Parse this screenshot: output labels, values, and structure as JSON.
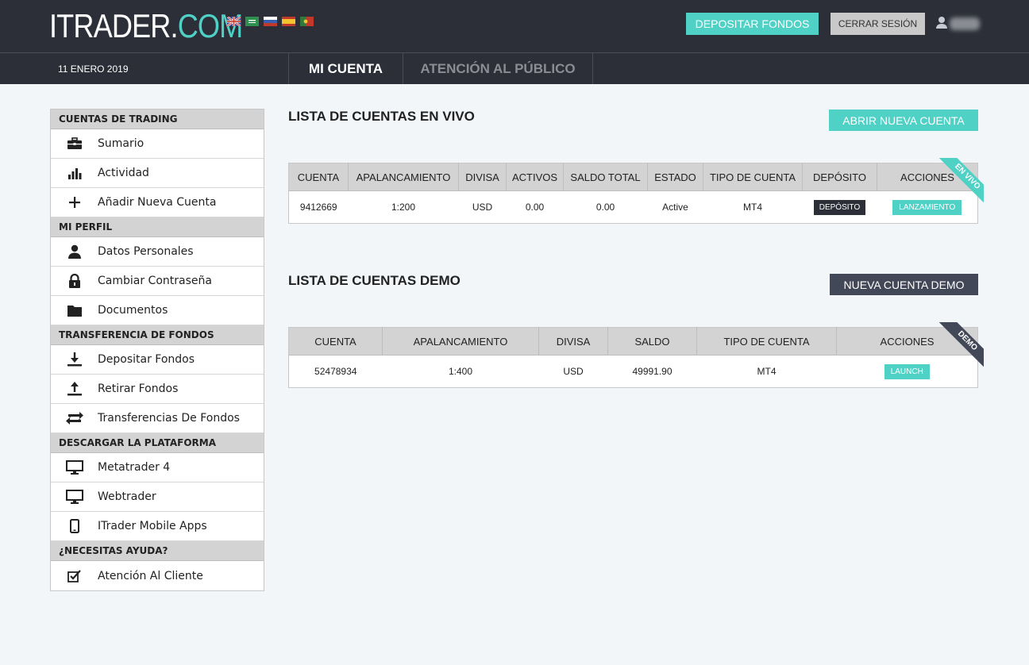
{
  "header": {
    "logo_part1": "ITRADER.",
    "logo_part2": "COM",
    "flags": [
      "uk-flag",
      "saudi-flag",
      "russia-flag",
      "spain-flag",
      "portugal-flag"
    ],
    "deposit_button": "DEPOSITAR FONDOS",
    "logout_button": "CERRAR SESIÓN"
  },
  "subheader": {
    "date": "11 ENERO 2019",
    "tabs": [
      "MI CUENTA",
      "ATENCIÓN AL PÚBLICO"
    ]
  },
  "sidebar": {
    "sections": [
      {
        "title": "CUENTAS DE TRADING",
        "items": [
          {
            "label": "Sumario",
            "icon": "briefcase-icon"
          },
          {
            "label": "Actividad",
            "icon": "bar-chart-icon"
          },
          {
            "label": "Añadir Nueva Cuenta",
            "icon": "plus-icon"
          }
        ]
      },
      {
        "title": "MI PERFIL",
        "items": [
          {
            "label": "Datos Personales",
            "icon": "user-icon"
          },
          {
            "label": "Cambiar Contraseña",
            "icon": "lock-icon"
          },
          {
            "label": "Documentos",
            "icon": "folder-icon"
          }
        ]
      },
      {
        "title": "TRANSFERENCIA DE FONDOS",
        "items": [
          {
            "label": "Depositar Fondos",
            "icon": "download-icon"
          },
          {
            "label": "Retirar Fondos",
            "icon": "upload-icon"
          },
          {
            "label": "Transferencias De Fondos",
            "icon": "transfer-icon"
          }
        ]
      },
      {
        "title": "DESCARGAR LA PLATAFORMA",
        "items": [
          {
            "label": "Metatrader 4",
            "icon": "monitor-icon"
          },
          {
            "label": "Webtrader",
            "icon": "monitor-icon"
          },
          {
            "label": "ITrader Mobile Apps",
            "icon": "mobile-icon"
          }
        ]
      },
      {
        "title": "¿NECESITAS AYUDA?",
        "items": [
          {
            "label": "Atención Al Cliente",
            "icon": "checkbox-icon"
          }
        ]
      }
    ]
  },
  "live": {
    "title": "LISTA DE CUENTAS EN VIVO",
    "new_button": "ABRIR NUEVA CUENTA",
    "ribbon": "EN VIVO",
    "columns": [
      "CUENTA",
      "APALANCAMIENTO",
      "DIVISA",
      "ACTIVOS",
      "SALDO TOTAL",
      "ESTADO",
      "TIPO DE CUENTA",
      "DEPÓSITO",
      "ACCIONES"
    ],
    "rows": [
      {
        "cuenta": "9412669",
        "apalancamiento": "1:200",
        "divisa": "USD",
        "activos": "0.00",
        "saldo_total": "0.00",
        "estado": "Active",
        "tipo": "MT4",
        "deposit_button": "DEPÓSITO",
        "action_button": "LANZAMIENTO"
      }
    ]
  },
  "demo": {
    "title": "LISTA DE CUENTAS DEMO",
    "new_button": "NUEVA CUENTA DEMO",
    "ribbon": "DEMO",
    "columns": [
      "CUENTA",
      "APALANCAMIENTO",
      "DIVISA",
      "SALDO",
      "TIPO DE CUENTA",
      "ACCIONES"
    ],
    "rows": [
      {
        "cuenta": "52478934",
        "apalancamiento": "1:400",
        "divisa": "USD",
        "saldo": "49991.90",
        "tipo": "MT4",
        "action_button": "LAUNCH"
      }
    ]
  },
  "colors": {
    "accent": "#4fd1c5",
    "dark": "#2c2f38",
    "demo_button": "#434858"
  }
}
